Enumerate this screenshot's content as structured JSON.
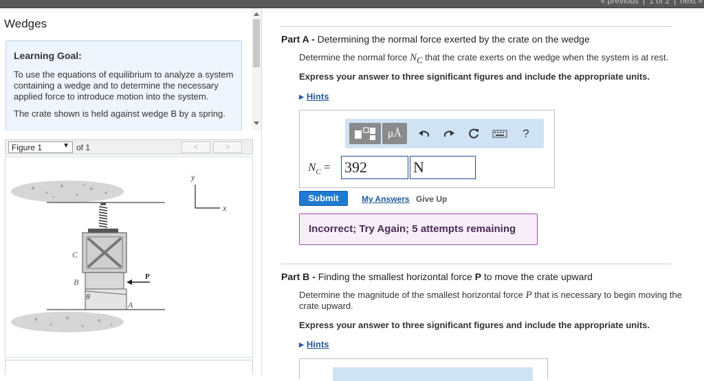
{
  "topnav": {
    "previous": "« previous",
    "sep1": "|",
    "page": "1 of 2",
    "sep2": "|",
    "next": "next »"
  },
  "left": {
    "title": "Wedges",
    "goal": {
      "title": "Learning Goal:",
      "text1": "To use the equations of equilibrium to analyze a system containing a wedge and to determine the necessary applied force to introduce motion into the system.",
      "text2": "The crate shown is held against wedge B by a spring."
    },
    "figure": {
      "selected": "Figure 1",
      "of": "of 1",
      "prev": "<",
      "next": ">",
      "labels": {
        "y": "y",
        "x": "x",
        "c": "C",
        "b": "B",
        "theta": "θ",
        "a": "A",
        "p": "P"
      }
    }
  },
  "partA": {
    "label": "Part A -",
    "title": "Determining the normal force exerted by the crate on the wedge",
    "desc_pre": "Determine the normal force ",
    "desc_var": "N",
    "desc_sub": "C",
    "desc_post": " that the crate exerts on the wedge when the system is at rest.",
    "instruction": "Express your answer to three significant figures and include the appropriate units.",
    "hints": "Hints",
    "toolbar": {
      "mu": "μÅ",
      "help": "?"
    },
    "eq_var": "N",
    "eq_sub": "C",
    "eq_sign": "=",
    "value": "392",
    "unit": "N",
    "submit": "Submit",
    "my_answers": "My Answers",
    "give_up": "Give Up",
    "feedback": "Incorrect; Try Again; 5 attempts remaining"
  },
  "partB": {
    "label": "Part B -",
    "title_pre": "Finding the smallest horizontal force ",
    "title_var": "P",
    "title_post": " to move the crate upward",
    "desc_pre": "Determine the magnitude of the smallest horizontal force ",
    "desc_var": "P",
    "desc_post": " that is necessary to begin moving the crate upward.",
    "instruction": "Express your answer to three significant figures and include the appropriate units.",
    "hints": "Hints"
  }
}
